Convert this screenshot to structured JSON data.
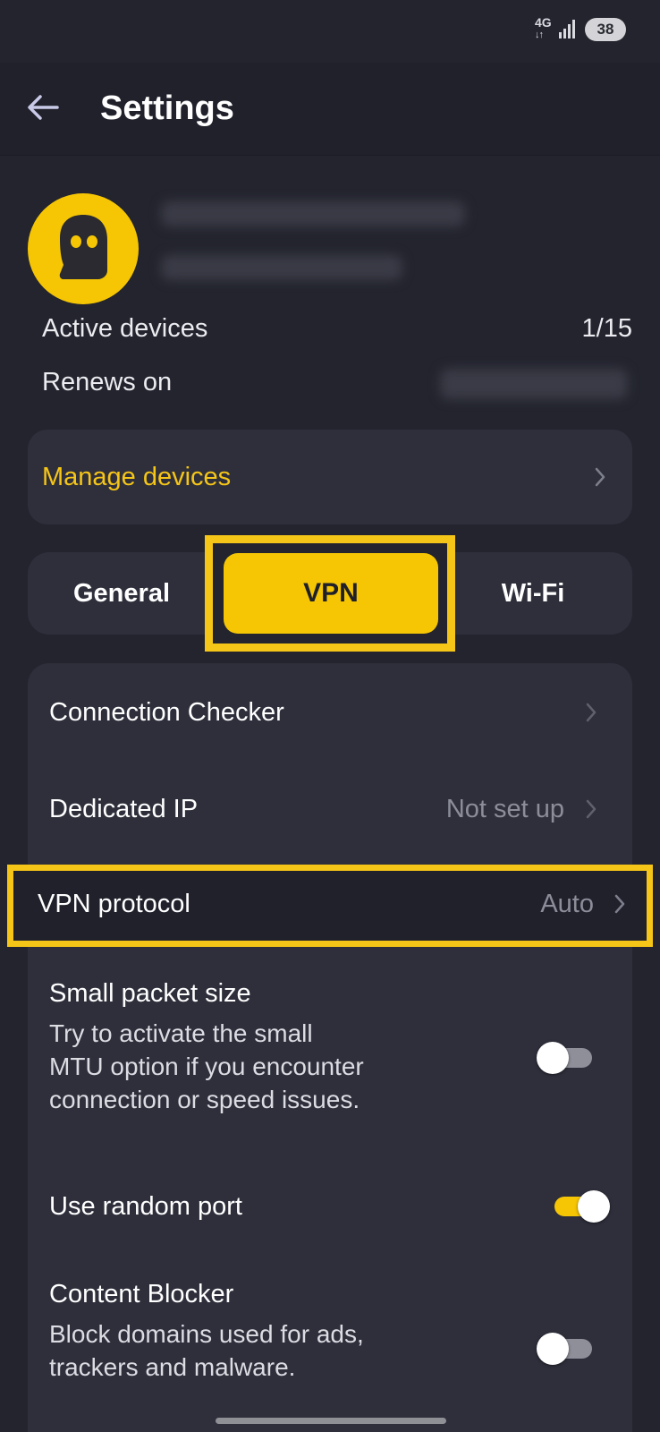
{
  "status_bar": {
    "network": "4G",
    "battery": "38"
  },
  "header": {
    "title": "Settings"
  },
  "account": {
    "active_devices_label": "Active devices",
    "active_devices_value": "1/15",
    "renews_on_label": "Renews on"
  },
  "manage_devices": {
    "label": "Manage devices"
  },
  "tabs": [
    {
      "label": "General"
    },
    {
      "label": "VPN"
    },
    {
      "label": "Wi-Fi"
    }
  ],
  "settings": {
    "connection_checker": {
      "title": "Connection Checker"
    },
    "dedicated_ip": {
      "title": "Dedicated IP",
      "value": "Not set up"
    },
    "vpn_protocol": {
      "title": "VPN protocol",
      "value": "Auto"
    },
    "small_packet": {
      "title": "Small packet size",
      "desc_lines": [
        "Try to activate the small",
        "MTU option if you encounter",
        "connection or speed issues."
      ],
      "enabled": false
    },
    "random_port": {
      "title": "Use random port",
      "enabled": true
    },
    "content_blocker": {
      "title": "Content Blocker",
      "desc_lines": [
        "Block domains used for ads,",
        "trackers and malware."
      ],
      "enabled": false
    }
  },
  "colors": {
    "accent": "#f6c604",
    "background": "#23242e",
    "card": "#2e2f3b"
  },
  "icons": {
    "back": "arrow-left-icon",
    "chevron": "chevron-right-icon",
    "logo": "cyberghost-ghost-icon",
    "signal": "signal-bars-icon"
  }
}
